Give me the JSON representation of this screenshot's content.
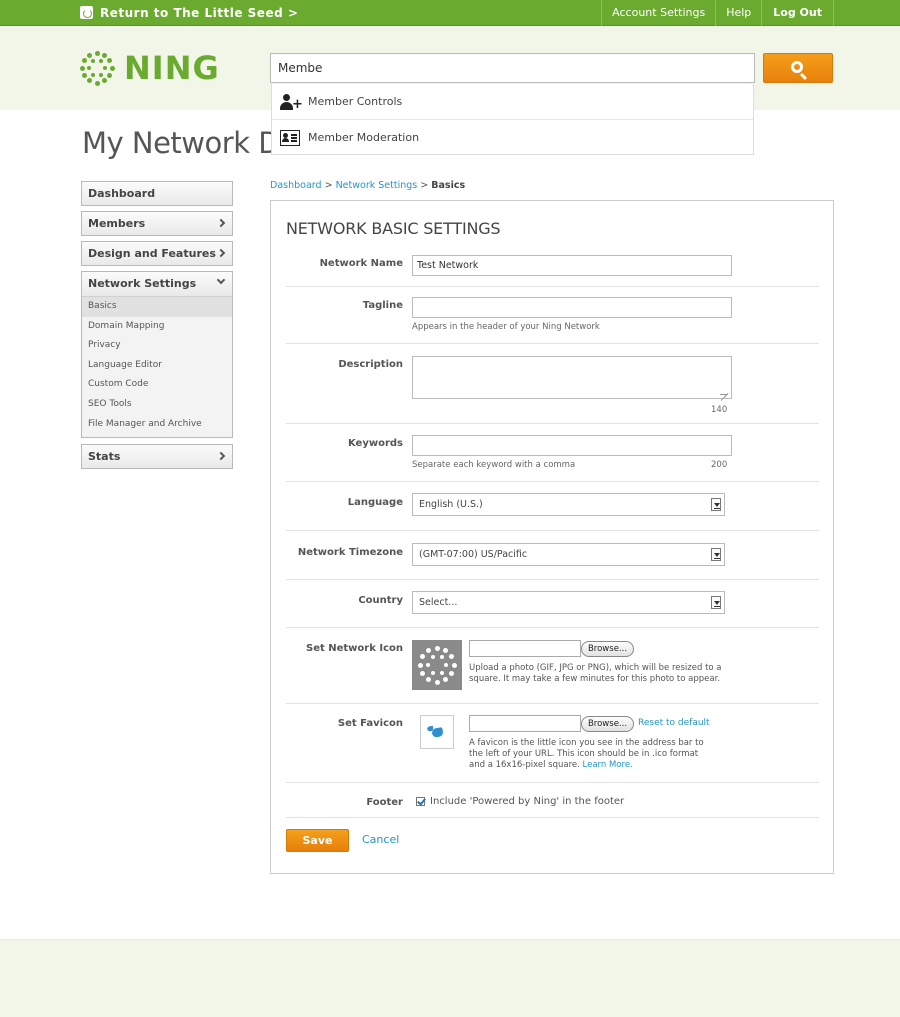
{
  "topbar": {
    "return_link": "Return to The Little Seed >",
    "account_settings": "Account Settings",
    "help": "Help",
    "logout": "Log Out"
  },
  "logo": {
    "text": "NING"
  },
  "search": {
    "value": "Membe",
    "icon": "search-icon",
    "suggestions": [
      {
        "label": "Member Controls",
        "icon": "user-add-icon"
      },
      {
        "label": "Member Moderation",
        "icon": "id-card-icon"
      }
    ]
  },
  "page_title": "My Network Dashboard",
  "sidebar": {
    "items": [
      {
        "label": "Dashboard"
      },
      {
        "label": "Members"
      },
      {
        "label": "Design and Features"
      },
      {
        "label": "Network Settings"
      },
      {
        "label": "Stats"
      }
    ],
    "network_settings_sub": [
      {
        "label": "Basics"
      },
      {
        "label": "Domain Mapping"
      },
      {
        "label": "Privacy"
      },
      {
        "label": "Language Editor"
      },
      {
        "label": "Custom Code"
      },
      {
        "label": "SEO Tools"
      },
      {
        "label": "File Manager and Archive"
      }
    ]
  },
  "breadcrumb": {
    "dashboard": "Dashboard",
    "network_settings": "Network Settings",
    "current": "Basics",
    "sep": ">"
  },
  "form": {
    "title": "NETWORK BASIC SETTINGS",
    "network_name": {
      "label": "Network Name",
      "value": "Test Network"
    },
    "tagline": {
      "label": "Tagline",
      "value": "",
      "hint": "Appears in the header of your Ning Network"
    },
    "description": {
      "label": "Description",
      "value": "",
      "count": "140"
    },
    "keywords": {
      "label": "Keywords",
      "value": "",
      "hint": "Separate each keyword with a comma",
      "count": "200"
    },
    "language": {
      "label": "Language",
      "selected": "English (U.S.)"
    },
    "timezone": {
      "label": "Network Timezone",
      "selected": "(GMT-07:00) US/Pacific"
    },
    "country": {
      "label": "Country",
      "selected": "Select..."
    },
    "network_icon": {
      "label": "Set Network Icon",
      "browse": "Browse...",
      "desc": "Upload a photo (GIF, JPG or PNG), which will be resized to a square. It may take a few minutes for this photo to appear."
    },
    "favicon": {
      "label": "Set Favicon",
      "browse": "Browse...",
      "reset": "Reset to default",
      "desc": "A favicon is the little icon you see in the address bar to the left of your URL. This icon should be in .ico format and a 16x16-pixel square.",
      "learn_more": "Learn More."
    },
    "footer": {
      "label": "Footer",
      "checkbox_label": "Include 'Powered by Ning' in the footer",
      "checked": true
    },
    "save": "Save",
    "cancel": "Cancel"
  }
}
